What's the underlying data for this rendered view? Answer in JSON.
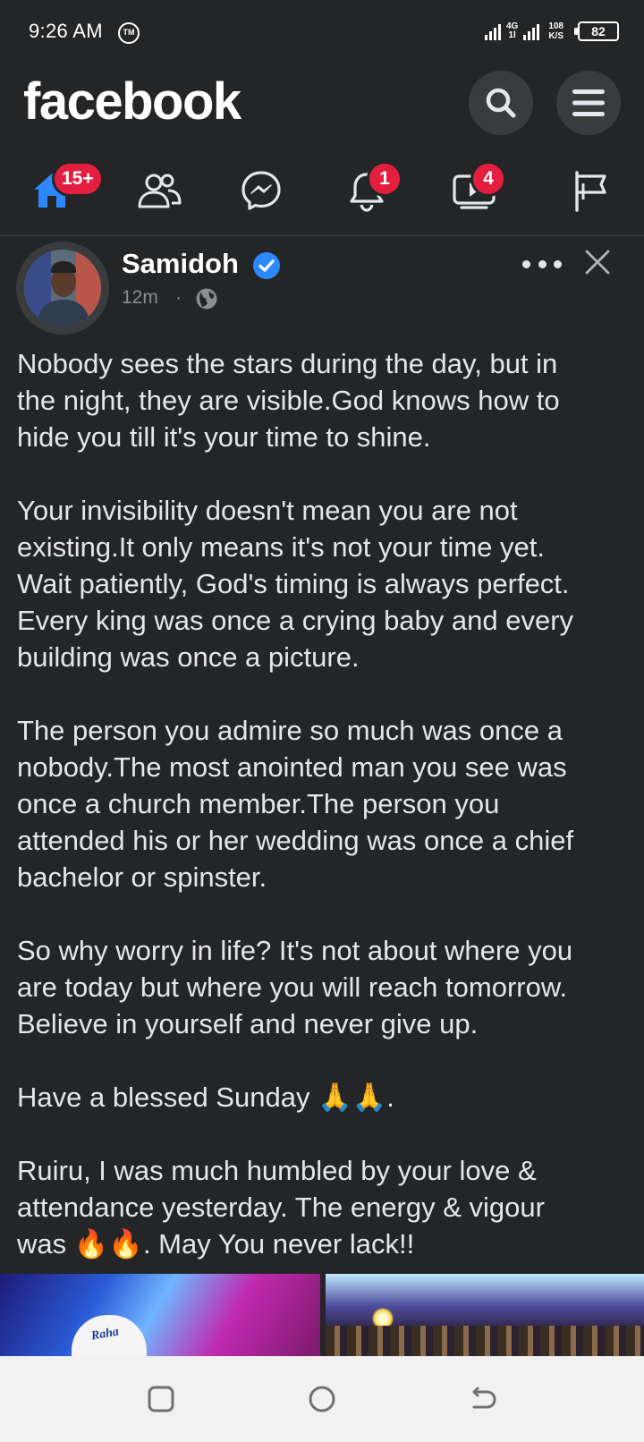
{
  "status_bar": {
    "time": "9:26 AM",
    "tm_badge": "TM",
    "network_top": "4G",
    "network_bottom": "1l",
    "speed_value": "108",
    "speed_unit": "K/S",
    "battery": "82"
  },
  "header": {
    "logo": "facebook",
    "search_icon": "search-icon",
    "menu_icon": "hamburger-menu-icon"
  },
  "nav": {
    "home_badge": "15+",
    "notifications_badge": "1",
    "video_badge": "4",
    "accent_color": "#2d88ff",
    "badge_color": "#e41e3f"
  },
  "post": {
    "author": "Samidoh",
    "time": "12m",
    "separator": "·",
    "paragraphs": [
      "Nobody sees the stars during the day, but in\nthe night, they are visible.God knows how to\nhide you till it's your time to shine.",
      "Your invisibility doesn't mean you are not\nexisting.It only means it's not your time yet.\nWait patiently, God's timing is always perfect.\nEvery king was once a crying baby and every\nbuilding was once a picture.",
      "The person you admire so much was once a\nnobody.The most anointed man you see was\nonce a church member.The person you\nattended his or her wedding was once a chief\nbachelor or spinster.",
      "So why worry in life? It's not about where you\nare today but where you will reach tomorrow.\nBelieve in yourself and never give up.",
      "Have a blessed Sunday 🙏🙏.",
      "Ruiru, I was much humbled by your love &\nattendance yesterday. The energy & vigour\nwas 🔥🔥. May You never lack!!"
    ],
    "photo_left_cap_text": "Raha"
  }
}
